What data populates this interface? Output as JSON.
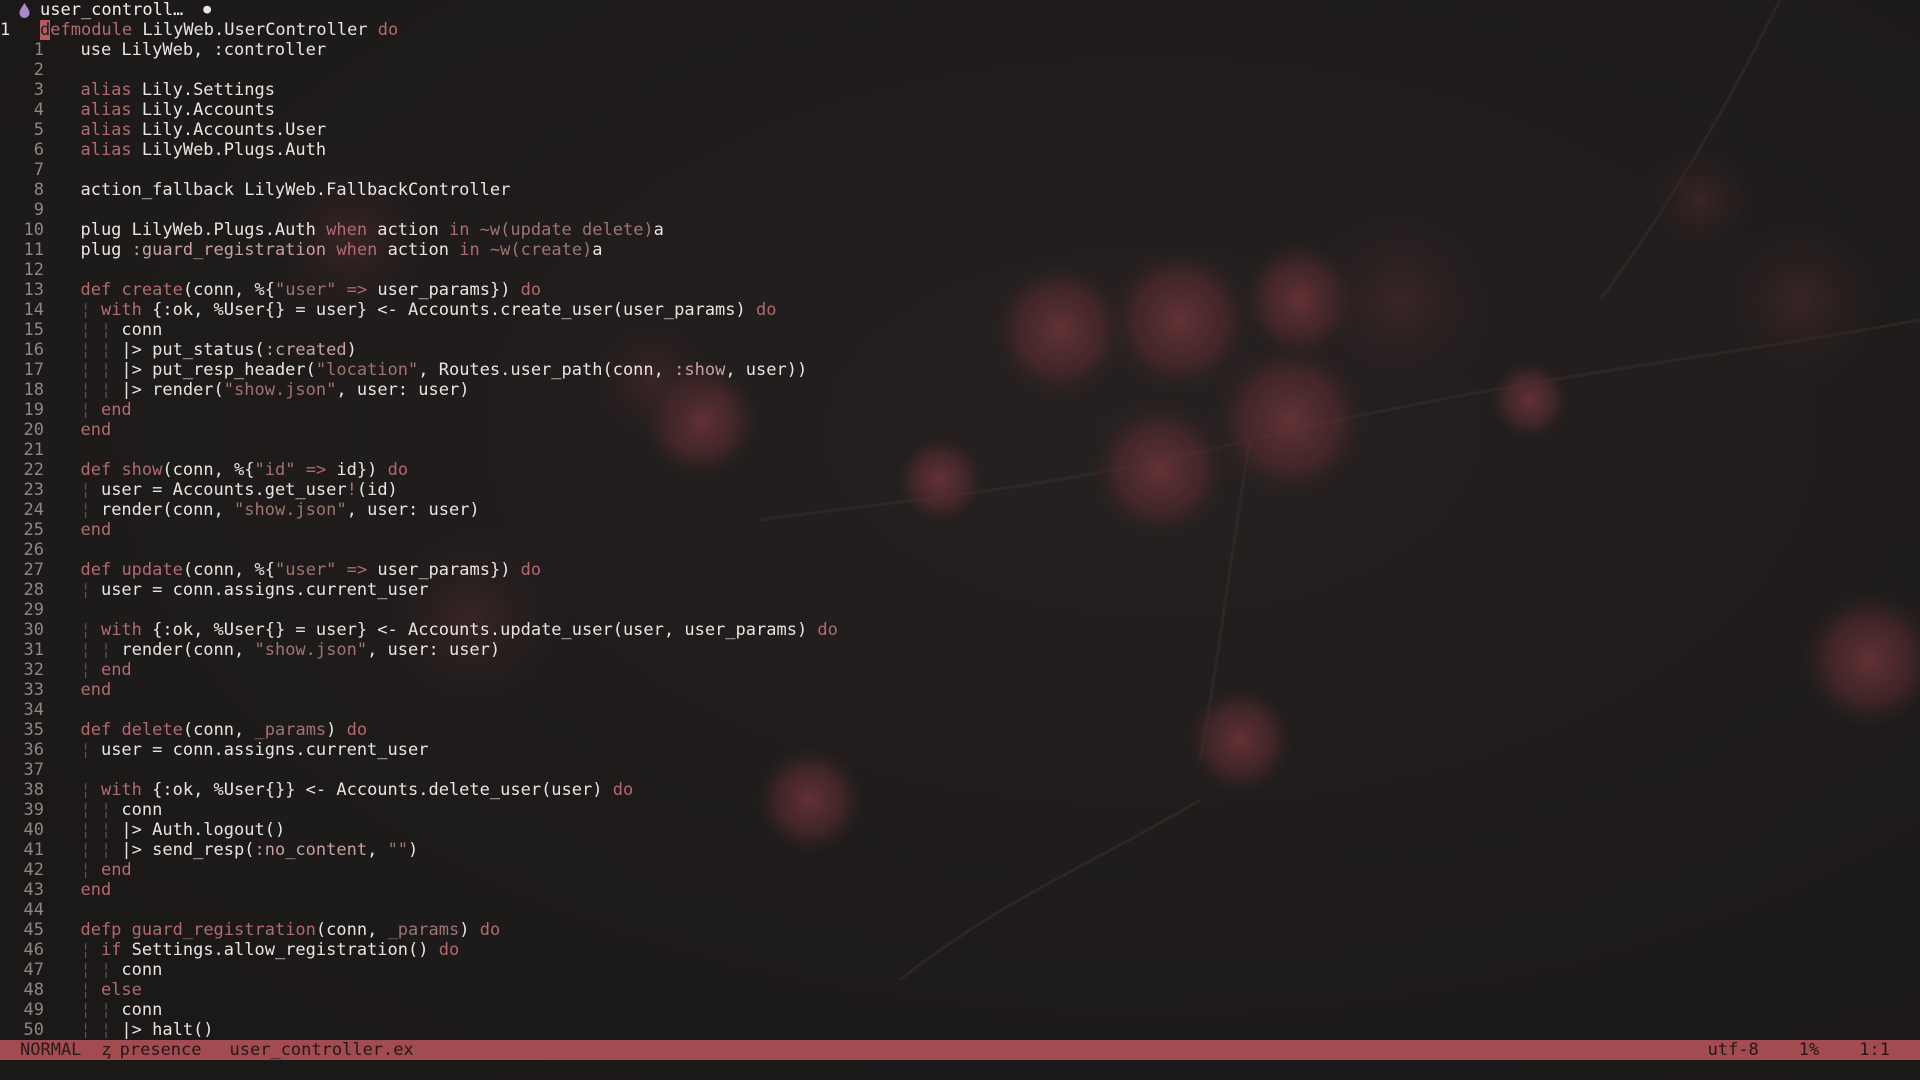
{
  "tab": {
    "label": "user_controll…",
    "icon": "elixir-drop-icon",
    "close": "●"
  },
  "status": {
    "mode": "NORMAL",
    "branch_icon": "ᶎ",
    "branch": "presence",
    "file": "user_controller.ex",
    "encoding": "utf-8",
    "percent": "1%",
    "position": "1:1"
  },
  "colors": {
    "accent": "#a24b51",
    "keyword": "#b16b6f",
    "background": "#1d1b1b"
  },
  "lines": [
    {
      "n": "1",
      "t": [
        [
          "k",
          "defmodule"
        ],
        [
          "p",
          " LilyWeb.UserController "
        ],
        [
          "k",
          "do"
        ]
      ]
    },
    {
      "n": "1",
      "t": [
        [
          "p",
          "  use LilyWeb, :controller"
        ]
      ]
    },
    {
      "n": "2",
      "t": []
    },
    {
      "n": "3",
      "t": [
        [
          "k",
          "  alias"
        ],
        [
          "p",
          " Lily.Settings"
        ]
      ]
    },
    {
      "n": "4",
      "t": [
        [
          "k",
          "  alias"
        ],
        [
          "p",
          " Lily.Accounts"
        ]
      ]
    },
    {
      "n": "5",
      "t": [
        [
          "k",
          "  alias"
        ],
        [
          "p",
          " Lily.Accounts.User"
        ]
      ]
    },
    {
      "n": "6",
      "t": [
        [
          "k",
          "  alias"
        ],
        [
          "p",
          " LilyWeb.Plugs.Auth"
        ]
      ]
    },
    {
      "n": "7",
      "t": []
    },
    {
      "n": "8",
      "t": [
        [
          "p",
          "  action_fallback LilyWeb.FallbackController"
        ]
      ]
    },
    {
      "n": "9",
      "t": []
    },
    {
      "n": "10",
      "t": [
        [
          "p",
          "  plug LilyWeb.Plugs.Auth "
        ],
        [
          "k",
          "when"
        ],
        [
          "p",
          " action "
        ],
        [
          "k",
          "in"
        ],
        [
          "s",
          " ~w(update delete)"
        ],
        [
          "p",
          "a"
        ]
      ]
    },
    {
      "n": "11",
      "t": [
        [
          "p",
          "  plug "
        ],
        [
          "sy",
          ":guard_registration"
        ],
        [
          "p",
          " "
        ],
        [
          "k",
          "when"
        ],
        [
          "p",
          " action "
        ],
        [
          "k",
          "in"
        ],
        [
          "s",
          " ~w(create)"
        ],
        [
          "p",
          "a"
        ]
      ]
    },
    {
      "n": "12",
      "t": []
    },
    {
      "n": "13",
      "t": [
        [
          "k",
          "  def"
        ],
        [
          "p",
          " "
        ],
        [
          "k",
          "create"
        ],
        [
          "p",
          "(conn, %{"
        ],
        [
          "s",
          "\"user\""
        ],
        [
          "p",
          " "
        ],
        [
          "k",
          "=>"
        ],
        [
          "p",
          " user_params}) "
        ],
        [
          "k",
          "do"
        ]
      ]
    },
    {
      "n": "14",
      "t": [
        [
          "g",
          "  ¦ "
        ],
        [
          "k",
          "with"
        ],
        [
          "p",
          " {:ok, %User{} = user} <- Accounts.create_user(user_params) "
        ],
        [
          "k",
          "do"
        ]
      ]
    },
    {
      "n": "15",
      "t": [
        [
          "g",
          "  ¦ ¦ "
        ],
        [
          "p",
          "conn"
        ]
      ]
    },
    {
      "n": "16",
      "t": [
        [
          "g",
          "  ¦ ¦ "
        ],
        [
          "p",
          "|> put_status("
        ],
        [
          "sy",
          ":created"
        ],
        [
          "p",
          ")"
        ]
      ]
    },
    {
      "n": "17",
      "t": [
        [
          "g",
          "  ¦ ¦ "
        ],
        [
          "p",
          "|> put_resp_header("
        ],
        [
          "s",
          "\"location\""
        ],
        [
          "p",
          ", Routes.user_path(conn, "
        ],
        [
          "sy",
          ":show"
        ],
        [
          "p",
          ", user))"
        ]
      ]
    },
    {
      "n": "18",
      "t": [
        [
          "g",
          "  ¦ ¦ "
        ],
        [
          "p",
          "|> render("
        ],
        [
          "s",
          "\"show.json\""
        ],
        [
          "p",
          ", user: user)"
        ]
      ]
    },
    {
      "n": "19",
      "t": [
        [
          "g",
          "  ¦ "
        ],
        [
          "k",
          "end"
        ]
      ]
    },
    {
      "n": "20",
      "t": [
        [
          "k",
          "  end"
        ]
      ]
    },
    {
      "n": "21",
      "t": []
    },
    {
      "n": "22",
      "t": [
        [
          "k",
          "  def"
        ],
        [
          "p",
          " "
        ],
        [
          "k",
          "show"
        ],
        [
          "p",
          "(conn, %{"
        ],
        [
          "s",
          "\"id\""
        ],
        [
          "p",
          " "
        ],
        [
          "k",
          "=>"
        ],
        [
          "p",
          " id}) "
        ],
        [
          "k",
          "do"
        ]
      ]
    },
    {
      "n": "23",
      "t": [
        [
          "g",
          "  ¦ "
        ],
        [
          "p",
          "user = Accounts.get_user"
        ],
        [
          "k",
          "!"
        ],
        [
          "p",
          "(id)"
        ]
      ]
    },
    {
      "n": "24",
      "t": [
        [
          "g",
          "  ¦ "
        ],
        [
          "p",
          "render(conn, "
        ],
        [
          "s",
          "\"show.json\""
        ],
        [
          "p",
          ", user: user)"
        ]
      ]
    },
    {
      "n": "25",
      "t": [
        [
          "k",
          "  end"
        ]
      ]
    },
    {
      "n": "26",
      "t": []
    },
    {
      "n": "27",
      "t": [
        [
          "k",
          "  def"
        ],
        [
          "p",
          " "
        ],
        [
          "k",
          "update"
        ],
        [
          "p",
          "(conn, %{"
        ],
        [
          "s",
          "\"user\""
        ],
        [
          "p",
          " "
        ],
        [
          "k",
          "=>"
        ],
        [
          "p",
          " user_params}) "
        ],
        [
          "k",
          "do"
        ]
      ]
    },
    {
      "n": "28",
      "t": [
        [
          "g",
          "  ¦ "
        ],
        [
          "p",
          "user = conn.assigns.current_user"
        ]
      ]
    },
    {
      "n": "29",
      "t": []
    },
    {
      "n": "30",
      "t": [
        [
          "g",
          "  ¦ "
        ],
        [
          "k",
          "with"
        ],
        [
          "p",
          " {:ok, %User{} = user} <- Accounts.update_user(user, user_params) "
        ],
        [
          "k",
          "do"
        ]
      ]
    },
    {
      "n": "31",
      "t": [
        [
          "g",
          "  ¦ ¦ "
        ],
        [
          "p",
          "render(conn, "
        ],
        [
          "s",
          "\"show.json\""
        ],
        [
          "p",
          ", user: user)"
        ]
      ]
    },
    {
      "n": "32",
      "t": [
        [
          "g",
          "  ¦ "
        ],
        [
          "k",
          "end"
        ]
      ]
    },
    {
      "n": "33",
      "t": [
        [
          "k",
          "  end"
        ]
      ]
    },
    {
      "n": "34",
      "t": []
    },
    {
      "n": "35",
      "t": [
        [
          "k",
          "  def"
        ],
        [
          "p",
          " "
        ],
        [
          "k",
          "delete"
        ],
        [
          "p",
          "(conn, "
        ],
        [
          "s",
          "_params"
        ],
        [
          "p",
          ") "
        ],
        [
          "k",
          "do"
        ]
      ]
    },
    {
      "n": "36",
      "t": [
        [
          "g",
          "  ¦ "
        ],
        [
          "p",
          "user = conn.assigns.current_user"
        ]
      ]
    },
    {
      "n": "37",
      "t": []
    },
    {
      "n": "38",
      "t": [
        [
          "g",
          "  ¦ "
        ],
        [
          "k",
          "with"
        ],
        [
          "p",
          " {:ok, %User{}} <- Accounts.delete_user(user) "
        ],
        [
          "k",
          "do"
        ]
      ]
    },
    {
      "n": "39",
      "t": [
        [
          "g",
          "  ¦ ¦ "
        ],
        [
          "p",
          "conn"
        ]
      ]
    },
    {
      "n": "40",
      "t": [
        [
          "g",
          "  ¦ ¦ "
        ],
        [
          "p",
          "|> Auth.logout()"
        ]
      ]
    },
    {
      "n": "41",
      "t": [
        [
          "g",
          "  ¦ ¦ "
        ],
        [
          "p",
          "|> send_resp("
        ],
        [
          "sy",
          ":no_content"
        ],
        [
          "p",
          ", "
        ],
        [
          "s",
          "\"\""
        ],
        [
          "p",
          ")"
        ]
      ]
    },
    {
      "n": "42",
      "t": [
        [
          "g",
          "  ¦ "
        ],
        [
          "k",
          "end"
        ]
      ]
    },
    {
      "n": "43",
      "t": [
        [
          "k",
          "  end"
        ]
      ]
    },
    {
      "n": "44",
      "t": []
    },
    {
      "n": "45",
      "t": [
        [
          "k",
          "  defp"
        ],
        [
          "p",
          " "
        ],
        [
          "k",
          "guard_registration"
        ],
        [
          "p",
          "(conn, "
        ],
        [
          "s",
          "_params"
        ],
        [
          "p",
          ") "
        ],
        [
          "k",
          "do"
        ]
      ]
    },
    {
      "n": "46",
      "t": [
        [
          "g",
          "  ¦ "
        ],
        [
          "k",
          "if"
        ],
        [
          "p",
          " Settings.allow_registration() "
        ],
        [
          "k",
          "do"
        ]
      ]
    },
    {
      "n": "47",
      "t": [
        [
          "g",
          "  ¦ ¦ "
        ],
        [
          "p",
          "conn"
        ]
      ]
    },
    {
      "n": "48",
      "t": [
        [
          "g",
          "  ¦ "
        ],
        [
          "k",
          "else"
        ]
      ]
    },
    {
      "n": "49",
      "t": [
        [
          "g",
          "  ¦ ¦ "
        ],
        [
          "p",
          "conn"
        ]
      ]
    },
    {
      "n": "50",
      "t": [
        [
          "g",
          "  ¦ ¦ "
        ],
        [
          "p",
          "|> halt()"
        ]
      ]
    }
  ]
}
